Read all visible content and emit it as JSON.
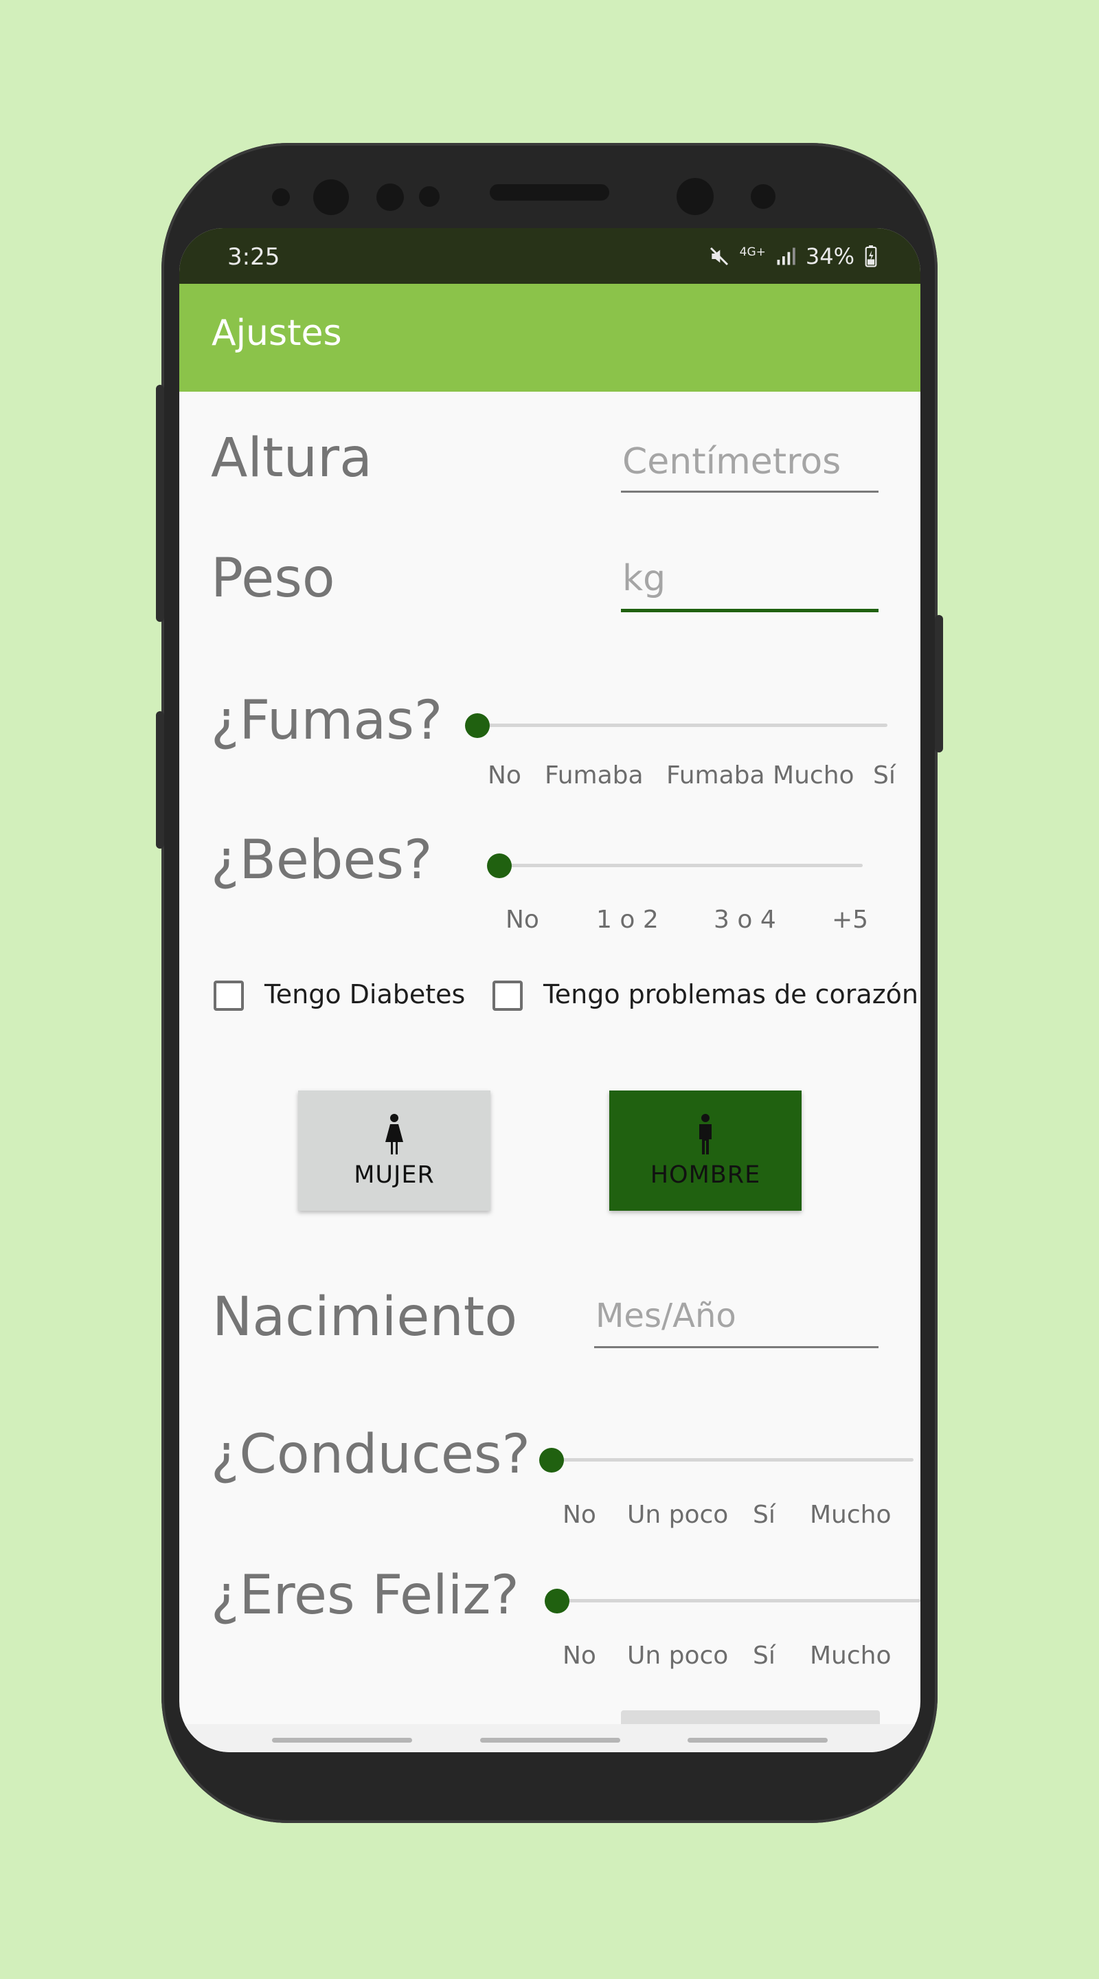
{
  "status_bar": {
    "time": "3:25",
    "network": "4G+",
    "battery": "34%"
  },
  "app_bar": {
    "title": "Ajustes"
  },
  "form": {
    "altura": {
      "label": "Altura",
      "placeholder": "Centímetros"
    },
    "peso": {
      "label": "Peso",
      "placeholder": "kg"
    },
    "fumas": {
      "label": "¿Fumas?",
      "value": 0,
      "options": [
        "No",
        "Fumaba",
        "Fumaba Mucho",
        "Sí"
      ]
    },
    "bebes": {
      "label": "¿Bebes?",
      "value": 0,
      "options": [
        "No",
        "1 o 2",
        "3 o 4",
        "+5"
      ]
    },
    "diabetes": {
      "label": "Tengo Diabetes",
      "checked": false
    },
    "corazon": {
      "label": "Tengo problemas de corazón",
      "checked": false
    },
    "gender": {
      "mujer": {
        "label": "MUJER",
        "selected": false,
        "color": "#d5d7d6"
      },
      "hombre": {
        "label": "HOMBRE",
        "selected": true,
        "color": "#206110"
      }
    },
    "nacimiento": {
      "label": "Nacimiento",
      "placeholder": "Mes/Año"
    },
    "conduces": {
      "label": "¿Conduces?",
      "value": 0,
      "options": [
        "No",
        "Un poco",
        "Sí",
        "Mucho"
      ]
    },
    "feliz": {
      "label": "¿Eres Feliz?",
      "value": 0,
      "options": [
        "No",
        "Un poco",
        "Sí",
        "Mucho"
      ]
    }
  },
  "colors": {
    "background": "#d2efbb",
    "app_bar": "#8bc34a",
    "status_bar": "#283318",
    "accent": "#206110"
  }
}
